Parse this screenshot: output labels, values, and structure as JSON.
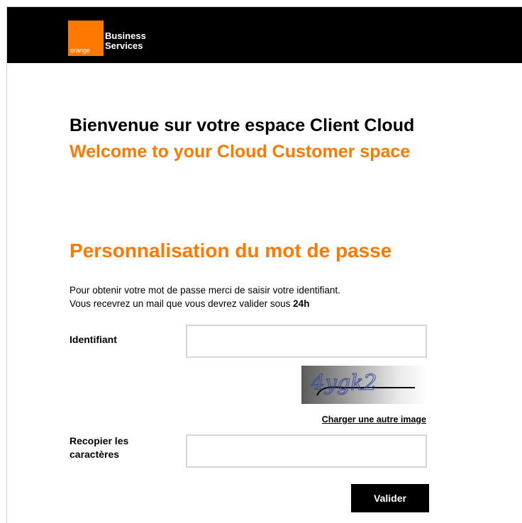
{
  "header": {
    "logo_text": "orange",
    "brand_line1": "Business",
    "brand_line2": "Services"
  },
  "welcome": {
    "title_fr": "Bienvenue sur votre espace Client Cloud",
    "title_en": "Welcome to your Cloud Customer space"
  },
  "section": {
    "title": "Personnalisation du mot de passe",
    "intro_line1": "Pour obtenir votre mot de passe merci de saisir votre identifiant.",
    "intro_line2_prefix": "Vous recevrez un mail que vous devrez valider sous ",
    "intro_line2_bold": "24h"
  },
  "form": {
    "identifiant_label": "Identifiant",
    "identifiant_value": "",
    "captcha_text": "4ygk2",
    "reload_link": "Charger une autre image",
    "recopier_label_line1": "Recopier les",
    "recopier_label_line2": "caractères",
    "recopier_value": "",
    "submit_label": "Valider"
  },
  "colors": {
    "accent": "#ff7900",
    "header_bg": "#000000",
    "button_bg": "#000000"
  }
}
